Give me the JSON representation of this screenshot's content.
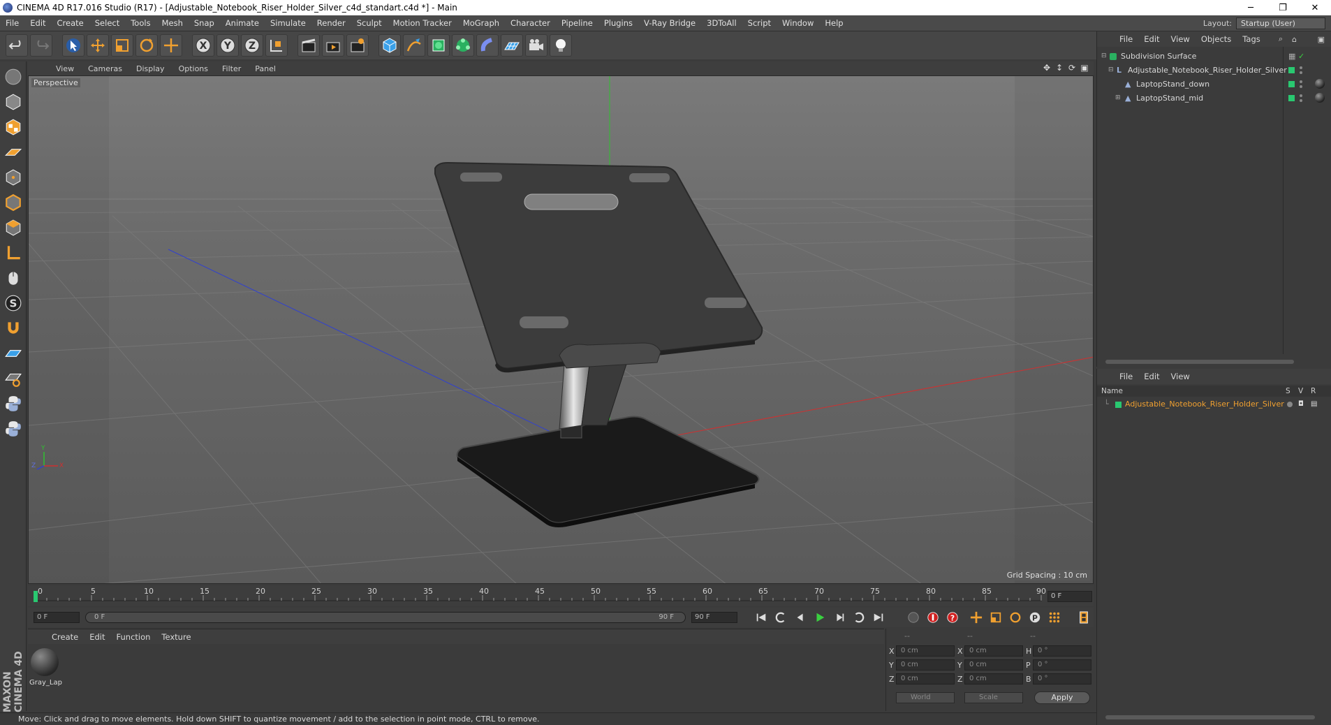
{
  "window": {
    "title": "CINEMA 4D R17.016 Studio (R17) - [Adjustable_Notebook_Riser_Holder_Silver_c4d_standart.c4d *] - Main",
    "minimize": "─",
    "restore": "❐",
    "close": "✕"
  },
  "menubar": {
    "items": [
      "File",
      "Edit",
      "Create",
      "Select",
      "Tools",
      "Mesh",
      "Snap",
      "Animate",
      "Simulate",
      "Render",
      "Sculpt",
      "Motion Tracker",
      "MoGraph",
      "Character",
      "Pipeline",
      "Plugins",
      "V-Ray Bridge",
      "3DToAll",
      "Script",
      "Window",
      "Help"
    ],
    "layout_label": "Layout:",
    "layout_value": "Startup (User)"
  },
  "viewport": {
    "menu": [
      "View",
      "Cameras",
      "Display",
      "Options",
      "Filter",
      "Panel"
    ],
    "label": "Perspective",
    "grid_spacing": "Grid Spacing : 10 cm",
    "axis": {
      "x": "X",
      "y": "Y",
      "z": "Z"
    }
  },
  "timeline": {
    "ticks": [
      "0",
      "5",
      "10",
      "15",
      "20",
      "25",
      "30",
      "35",
      "40",
      "45",
      "50",
      "55",
      "60",
      "65",
      "70",
      "75",
      "80",
      "85",
      "90"
    ],
    "frame_end": "0 F"
  },
  "transport": {
    "current": "0 F",
    "range_start": "0 F",
    "range_end": "90 F",
    "max": "90 F"
  },
  "material_manager": {
    "menu": [
      "Create",
      "Edit",
      "Function",
      "Texture"
    ],
    "material_name": "Gray_Lap"
  },
  "coordinates": {
    "header": [
      "--",
      "--",
      "--"
    ],
    "labels_left": [
      "X",
      "Y",
      "Z"
    ],
    "labels_mid": [
      "X",
      "Y",
      "Z"
    ],
    "labels_right": [
      "H",
      "P",
      "B"
    ],
    "pos": [
      "0 cm",
      "0 cm",
      "0 cm"
    ],
    "size": [
      "0 cm",
      "0 cm",
      "0 cm"
    ],
    "rot": [
      "0 °",
      "0 °",
      "0 °"
    ],
    "mode_world": "World",
    "mode_scale": "Scale",
    "apply": "Apply"
  },
  "object_manager": {
    "menu": [
      "File",
      "Edit",
      "View",
      "Objects",
      "Tags"
    ],
    "objects": [
      {
        "name": "Subdivision Surface"
      },
      {
        "name": "Adjustable_Notebook_Riser_Holder_Silver"
      },
      {
        "name": "LaptopStand_down"
      },
      {
        "name": "LaptopStand_mid"
      }
    ]
  },
  "attribute_manager": {
    "menu": [
      "File",
      "Edit",
      "View"
    ],
    "columns": {
      "name": "Name",
      "s": "S",
      "v": "V",
      "r": "R"
    },
    "row_name": "Adjustable_Notebook_Riser_Holder_Silver"
  },
  "status": {
    "text": "Move: Click and drag to move elements. Hold down SHIFT to quantize movement / add to the selection in point mode, CTRL to remove."
  },
  "branding": {
    "logo_text": "MAXON CINEMA 4D"
  },
  "colors": {
    "accent_orange": "#f0a030",
    "tag_green": "#29c870",
    "axis_x": "#d03030",
    "axis_y": "#30c030",
    "axis_z": "#3040d0"
  }
}
